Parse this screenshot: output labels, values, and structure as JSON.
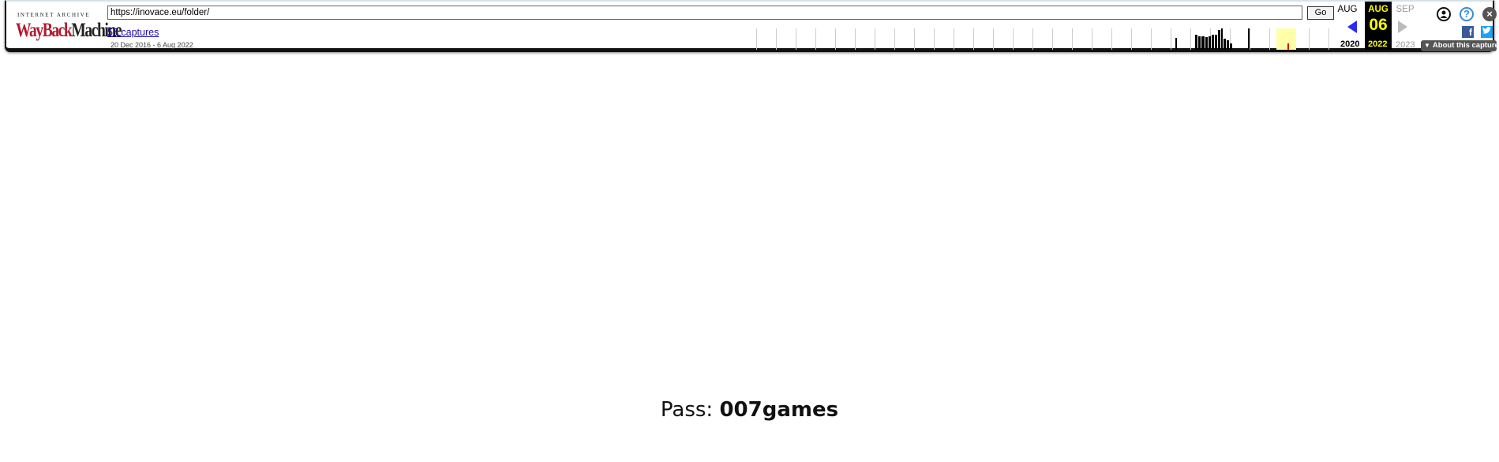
{
  "toolbar": {
    "logo_top": "INTERNET ARCHIVE",
    "logo_wb": "WayBack",
    "logo_m": "Machine",
    "url": "https://inovace.eu/folder/",
    "go_label": "Go",
    "captures_label": "55 captures",
    "range_label": "20 Dec 2016 - 6 Aug 2022",
    "prev_month": "AUG",
    "cur_month": "AUG",
    "next_month": "SEP",
    "cur_day": "06",
    "prev_year": "2020",
    "cur_year": "2022",
    "next_year": "2023",
    "about_label": "About this capture",
    "accent_current": "#ffff00",
    "accent_prev_arrow": "#2a2af0"
  },
  "page": {
    "pass_label": "Pass:",
    "pass_value": "007games"
  }
}
